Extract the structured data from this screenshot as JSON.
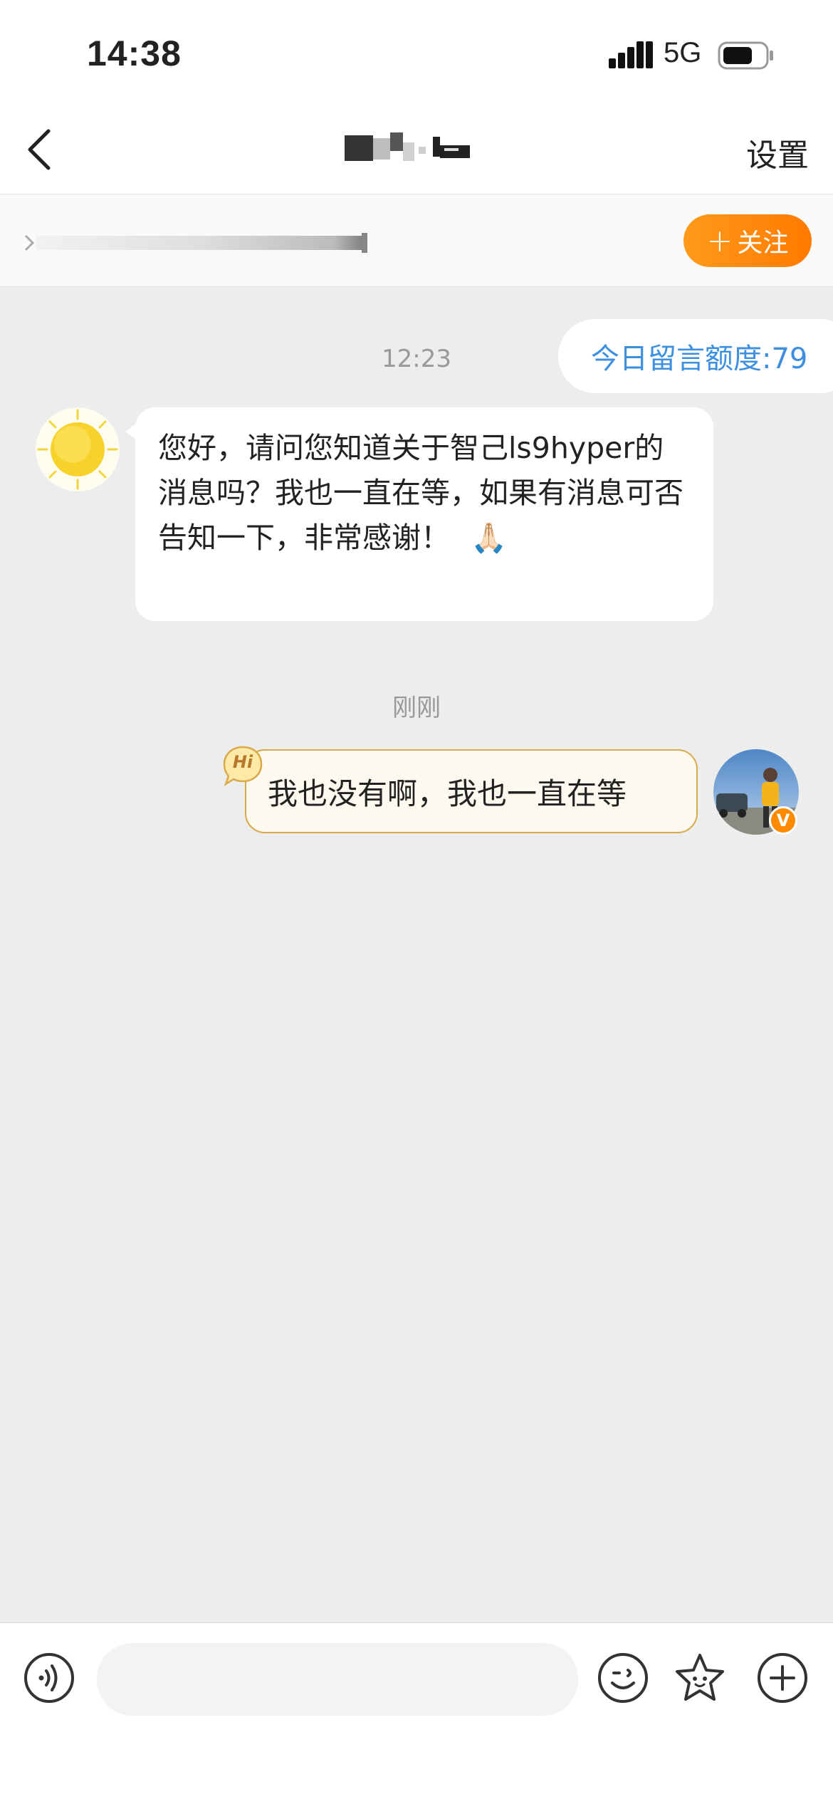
{
  "status_bar": {
    "time": "14:38",
    "network": "5G"
  },
  "header": {
    "settings_label": "设置"
  },
  "follow_bar": {
    "follow_label": "关注"
  },
  "chat": {
    "quota_label": "今日留言额度:79",
    "messages": [
      {
        "timestamp": "12:23",
        "sender": "other",
        "text": "您好，请问您知道关于智己ls9hyper的消息吗？我也一直在等，如果有消息可否告知一下，非常感谢！",
        "emoji": "🙏🏻"
      },
      {
        "timestamp": "刚刚",
        "sender": "me",
        "text": "我也没有啊，我也一直在等",
        "badge": "Hi"
      }
    ],
    "verified_badge": "V"
  },
  "input_bar": {
    "placeholder": ""
  },
  "colors": {
    "accent_orange": "#ff8a00",
    "quota_blue": "#3d8fe0",
    "my_bubble_border": "#d9a94a",
    "background": "#ededed"
  }
}
